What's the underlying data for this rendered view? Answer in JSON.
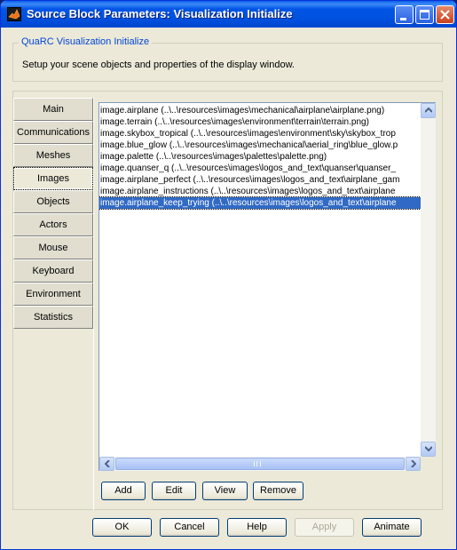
{
  "window": {
    "title": "Source Block Parameters: Visualization Initialize",
    "controls": [
      "minimize-icon",
      "maximize-icon",
      "close-icon"
    ]
  },
  "description": {
    "group_title": "QuaRC Visualization Initialize",
    "text": "Setup your scene objects and properties of the display window."
  },
  "tabs": [
    {
      "label": "Main",
      "active": false
    },
    {
      "label": "Communications",
      "active": false
    },
    {
      "label": "Meshes",
      "active": false
    },
    {
      "label": "Images",
      "active": true
    },
    {
      "label": "Objects",
      "active": false
    },
    {
      "label": "Actors",
      "active": false
    },
    {
      "label": "Mouse",
      "active": false
    },
    {
      "label": "Keyboard",
      "active": false
    },
    {
      "label": "Environment",
      "active": false
    },
    {
      "label": "Statistics",
      "active": false
    }
  ],
  "images_list": {
    "items": [
      "image.airplane (..\\..\\resources\\images\\mechanical\\airplane\\airplane.png)",
      "image.terrain (..\\..\\resources\\images\\environment\\terrain\\terrain.png)",
      "image.skybox_tropical (..\\..\\resources\\images\\environment\\sky\\skybox_trop",
      "image.blue_glow (..\\..\\resources\\images\\mechanical\\aerial_ring\\blue_glow.p",
      "image.palette (..\\..\\resources\\images\\palettes\\palette.png)",
      "image.quanser_q (..\\..\\resources\\images\\logos_and_text\\quanser\\quanser_",
      "image.airplane_perfect (..\\..\\resources\\images\\logos_and_text\\airplane_gam",
      "image.airplane_instructions (..\\..\\resources\\images\\logos_and_text\\airplane",
      "image.airplane_keep_trying (..\\..\\resources\\images\\logos_and_text\\airplane"
    ],
    "selected_index": 8,
    "scrollbar_grip": "III"
  },
  "list_buttons": {
    "add": "Add",
    "edit": "Edit",
    "view": "View",
    "remove": "Remove"
  },
  "dialog_buttons": {
    "ok": "OK",
    "cancel": "Cancel",
    "help": "Help",
    "apply": "Apply",
    "apply_disabled": true,
    "animate": "Animate"
  },
  "colors": {
    "title_bar": "#0055e5",
    "selection": "#316ac5",
    "legend_text": "#0046d5",
    "dialog_background": "#ece9d8"
  }
}
